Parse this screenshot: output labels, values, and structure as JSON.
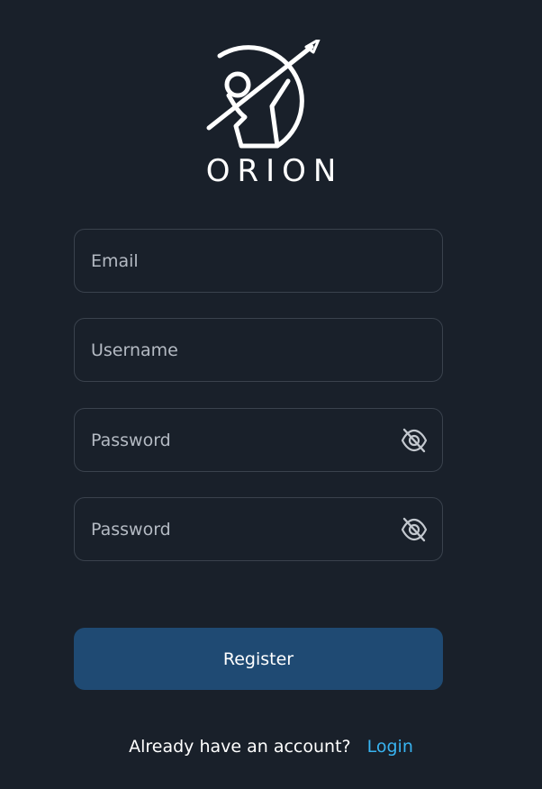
{
  "brand": {
    "name": "ORION",
    "logo_icon": "archer-logo-icon",
    "color": "#ffffff"
  },
  "form": {
    "email": {
      "placeholder": "Email",
      "value": ""
    },
    "username": {
      "placeholder": "Username",
      "value": ""
    },
    "password": {
      "placeholder": "Password",
      "value": "",
      "toggle_icon": "eye-slash-icon"
    },
    "confirm_password": {
      "placeholder": "Password",
      "value": "",
      "toggle_icon": "eye-slash-icon"
    }
  },
  "actions": {
    "register_label": "Register"
  },
  "footer": {
    "prompt": "Already have an account?",
    "login_label": "Login"
  },
  "colors": {
    "background": "#19202a",
    "field_border": "#3a424d",
    "primary_button": "#1f4a73",
    "link": "#38b3f0"
  }
}
